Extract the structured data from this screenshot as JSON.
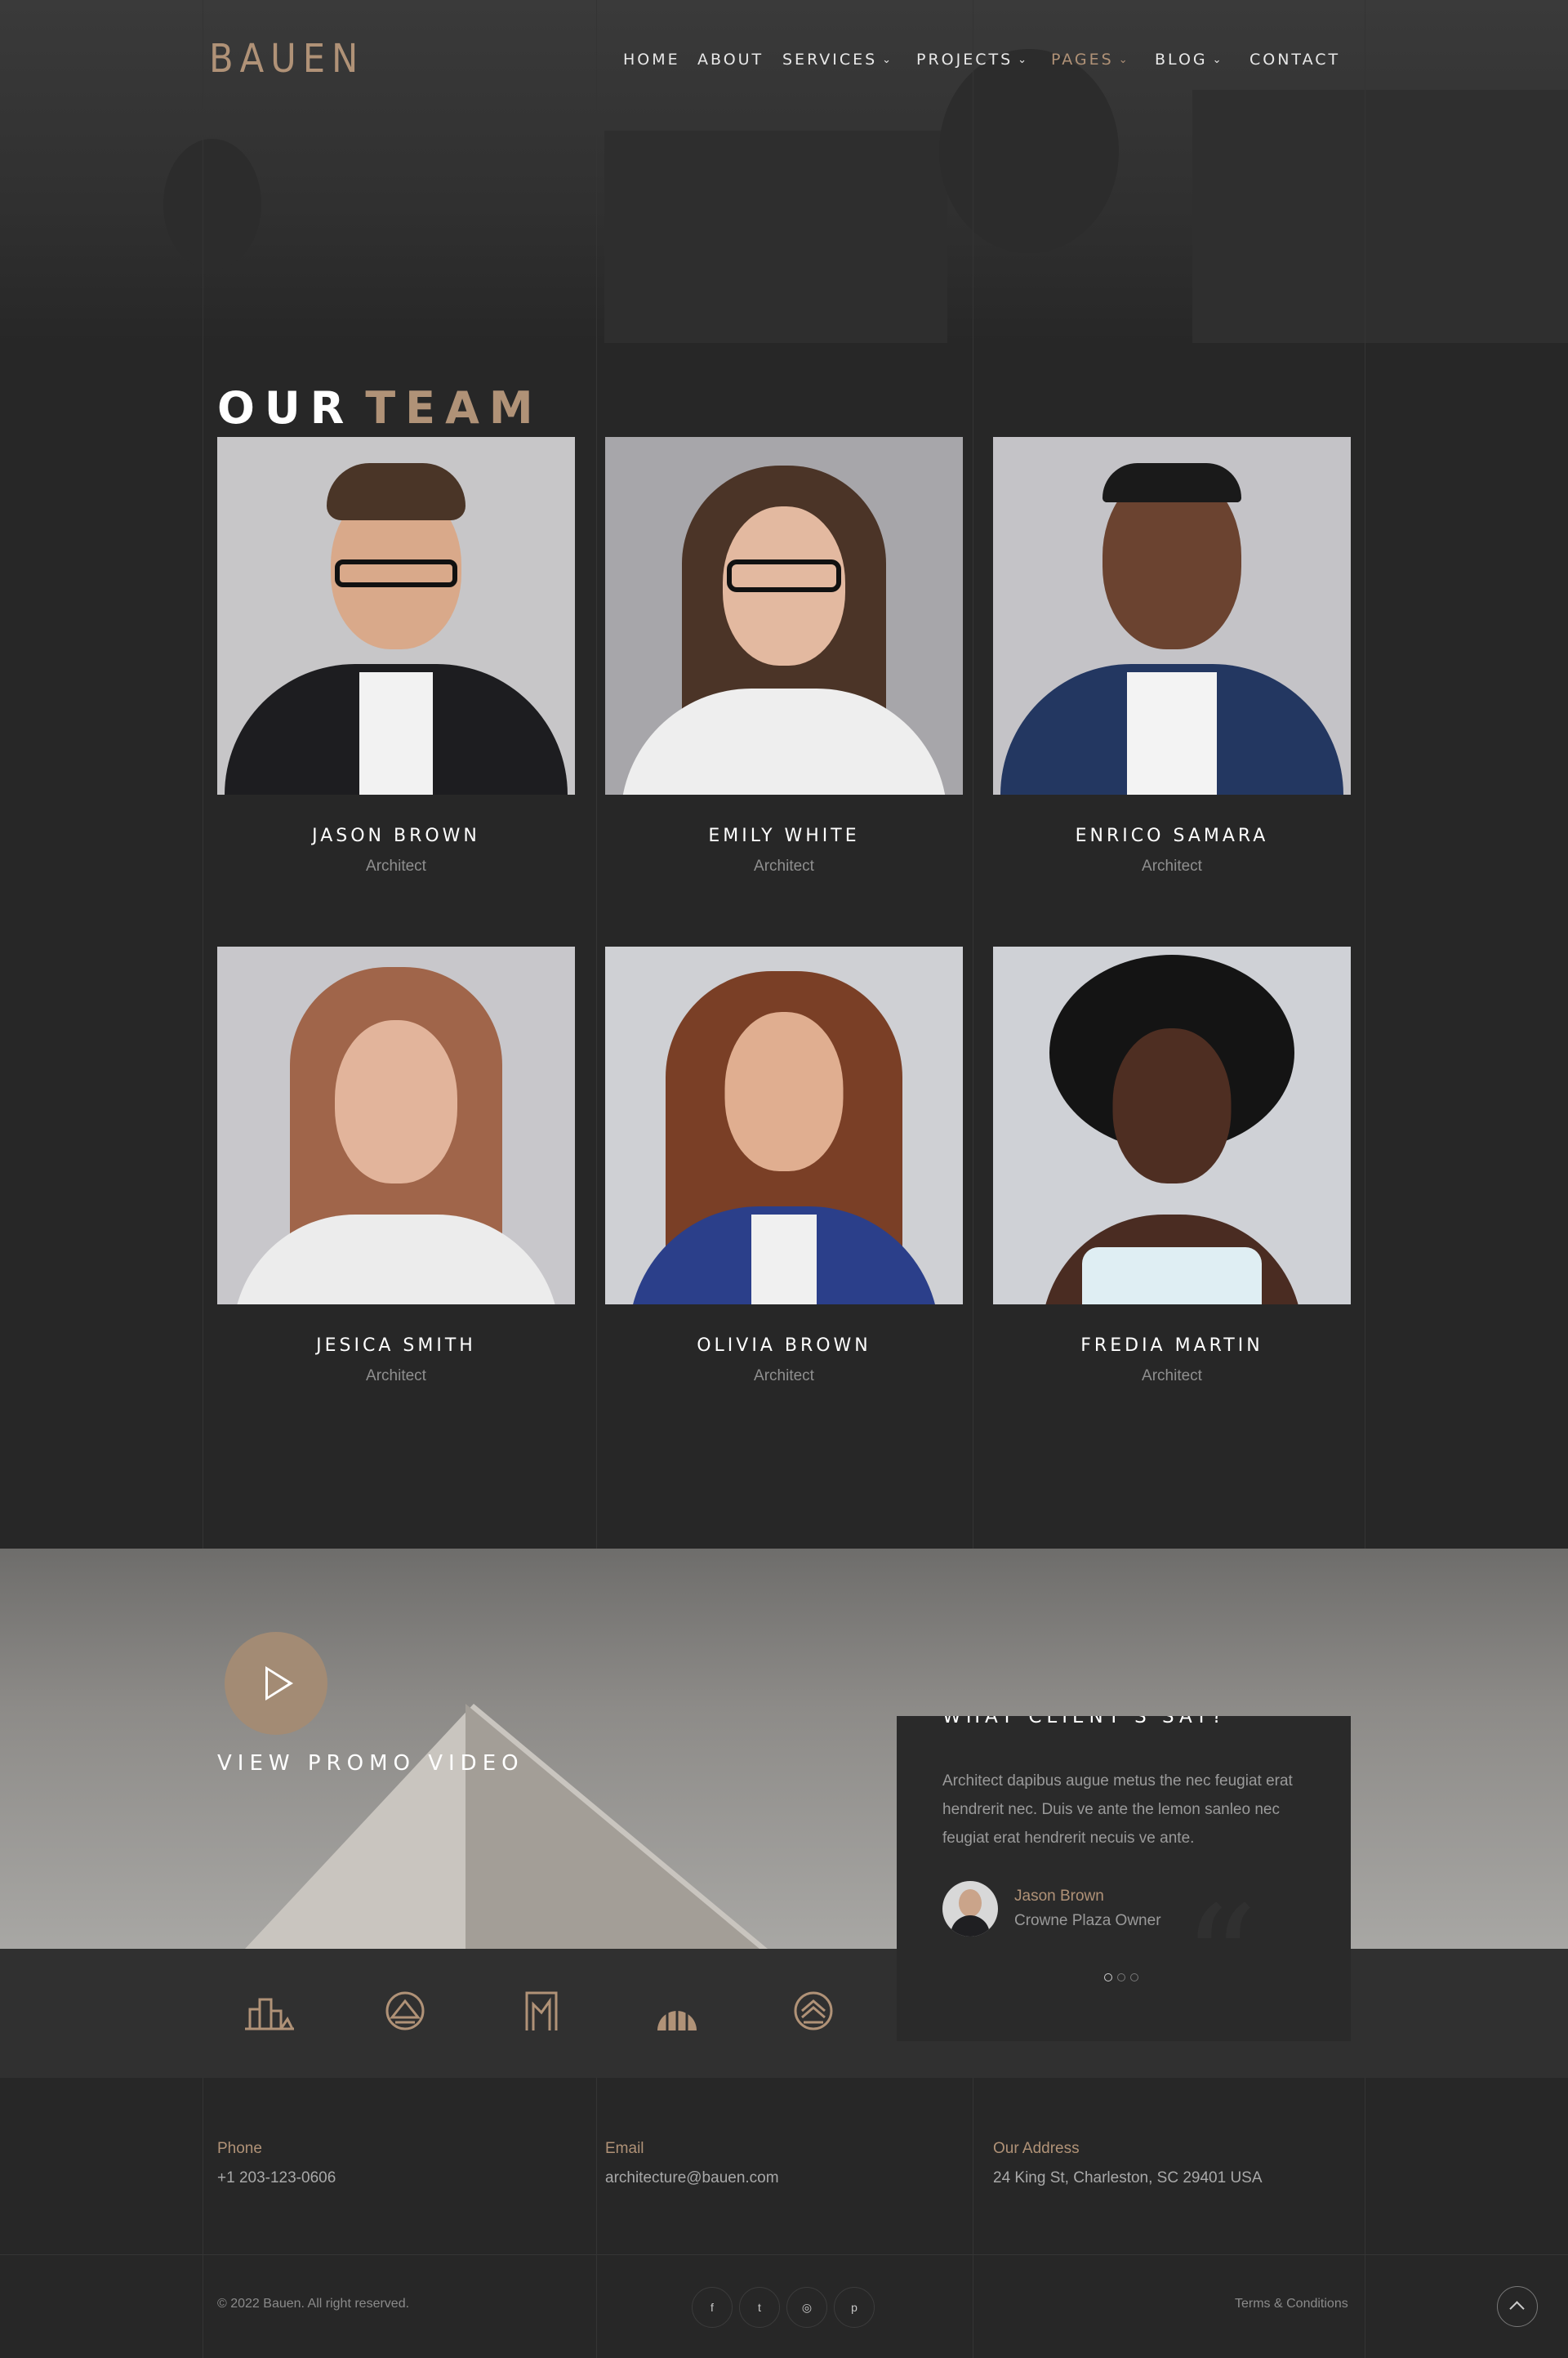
{
  "brand": {
    "logo_text": "BAUEN"
  },
  "nav": {
    "items": [
      {
        "label": "HOME",
        "has_dropdown": false,
        "active": false
      },
      {
        "label": "ABOUT",
        "has_dropdown": false,
        "active": false
      },
      {
        "label": "SERVICES",
        "has_dropdown": true,
        "active": false
      },
      {
        "label": "PROJECTS",
        "has_dropdown": true,
        "active": false
      },
      {
        "label": "PAGES",
        "has_dropdown": true,
        "active": true
      },
      {
        "label": "BLOG",
        "has_dropdown": true,
        "active": false
      },
      {
        "label": "CONTACT",
        "has_dropdown": false,
        "active": false
      }
    ]
  },
  "team": {
    "title_main": "OUR",
    "title_accent": "TEAM",
    "members": [
      {
        "name": "JASON BROWN",
        "role": "Architect"
      },
      {
        "name": "EMILY WHITE",
        "role": "Architect"
      },
      {
        "name": "ENRICO SAMARA",
        "role": "Architect"
      },
      {
        "name": "JESICA SMITH",
        "role": "Architect"
      },
      {
        "name": "OLIVIA BROWN",
        "role": "Architect"
      },
      {
        "name": "FREDIA MARTIN",
        "role": "Architect"
      }
    ]
  },
  "promo": {
    "label": "VIEW PROMO VIDEO",
    "play_icon": "play-icon"
  },
  "testimonials": {
    "heading": "WHAT CLIENT'S SAY?",
    "text": "Architect dapibus augue metus the nec feugiat erat hendrerit nec. Duis ve ante the lemon sanleo nec feugiat erat hendrerit necuis ve ante.",
    "author": "Jason Brown",
    "author_role": "Crowne Plaza Owner",
    "slides": 3,
    "active_slide": 1
  },
  "clients": {
    "logos": [
      "buildings-logo-icon",
      "pyramid-circle-logo-icon",
      "arch-frame-logo-icon",
      "dome-logo-icon",
      "layers-circle-logo-icon"
    ]
  },
  "contact": {
    "phone_label": "Phone",
    "phone": "+1 203-123-0606",
    "email_label": "Email",
    "email": "architecture@bauen.com",
    "address_label": "Our Address",
    "address": "24 King St, Charleston, SC 29401 USA"
  },
  "footer": {
    "copyright": "© 2022 Bauen. All right reserved.",
    "terms": "Terms & Conditions",
    "social": [
      {
        "icon": "facebook-icon",
        "glyph": "f"
      },
      {
        "icon": "twitter-icon",
        "glyph": "t"
      },
      {
        "icon": "instagram-icon",
        "glyph": "◎"
      },
      {
        "icon": "pinterest-icon",
        "glyph": "p"
      }
    ]
  },
  "colors": {
    "accent": "#b09277",
    "background": "#272727",
    "text": "#ffffff",
    "muted": "#8f8f8f"
  }
}
